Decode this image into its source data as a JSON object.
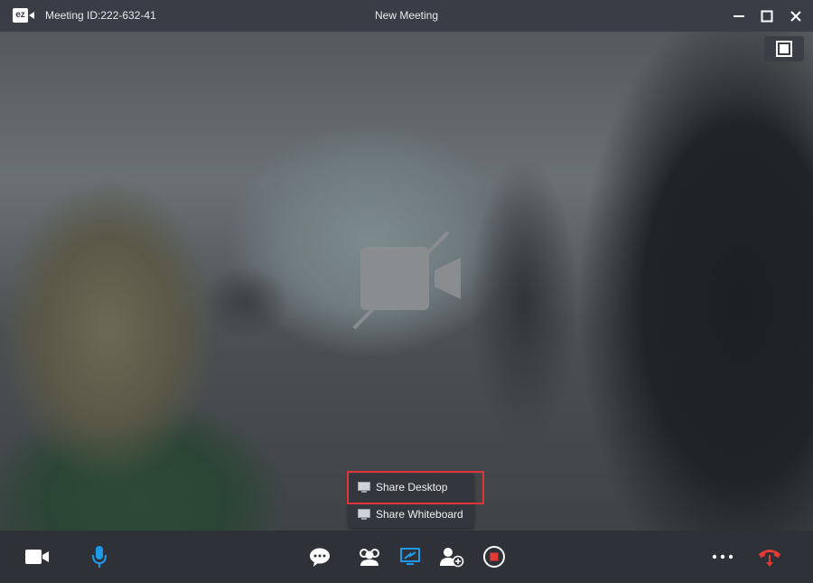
{
  "titlebar": {
    "logo_text": "ez",
    "meeting_id": "Meeting ID:222-632-41",
    "title": "New Meeting"
  },
  "video": {
    "status": "camera-off",
    "icon": "camera-off-icon"
  },
  "share_menu": {
    "items": [
      {
        "label": "Share Desktop",
        "icon": "monitor-icon",
        "highlighted": true
      },
      {
        "label": "Share Whiteboard",
        "icon": "monitor-icon",
        "highlighted": false
      }
    ]
  },
  "toolbar": {
    "left": [
      "video-camera-icon",
      "microphone-icon"
    ],
    "center": [
      "chat-icon",
      "participants-icon",
      "share-screen-icon",
      "add-user-icon",
      "record-icon"
    ],
    "right": [
      "more-icon",
      "hang-up-icon"
    ]
  },
  "colors": {
    "accent_blue": "#1e9be8",
    "hangup_red": "#e53935",
    "record_red": "#e53935",
    "highlight_border": "#e0343b"
  }
}
